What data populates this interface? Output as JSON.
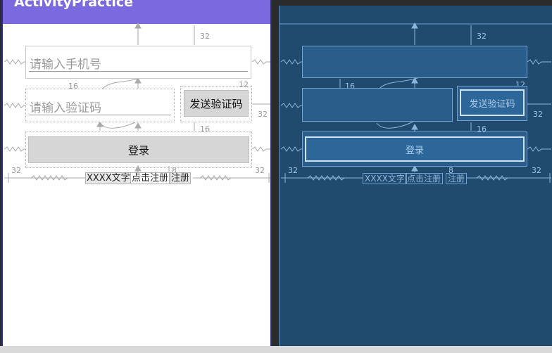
{
  "app": {
    "title": "ActivityPractice"
  },
  "design": {
    "phone_hint": "请输入手机号",
    "code_hint": "请输入验证码",
    "send_code_label": "发送验证码",
    "login_label": "登录",
    "footer": {
      "text1": "XXXX文字",
      "link1": "点击注册",
      "link2": "注册"
    },
    "margins": {
      "m32": "32",
      "m16": "16",
      "m12": "12",
      "m8": "8"
    }
  },
  "blueprint": {
    "send_code_label": "发送验证码",
    "login_label": "登录",
    "footer": {
      "text1": "XXXX文字",
      "link1": "点击注册",
      "link2": "注册"
    },
    "margins": {
      "m32": "32",
      "m16": "16",
      "m12": "12",
      "m8": "8"
    }
  },
  "colors": {
    "appbar": "#7b69e0",
    "blueprint_bg": "#204a6e",
    "blueprint_line": "#6fa0cf"
  }
}
